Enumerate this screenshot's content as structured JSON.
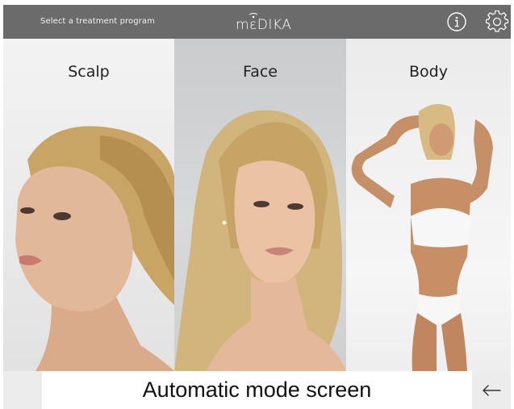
{
  "header": {
    "prompt": "Select a treatment program",
    "logo_text": "mɛDIKA",
    "icons": {
      "info": "info-icon",
      "settings": "gear-icon"
    }
  },
  "panels": [
    {
      "id": "scalp",
      "label": "Scalp"
    },
    {
      "id": "face",
      "label": "Face"
    },
    {
      "id": "body",
      "label": "Body"
    }
  ],
  "footer": {
    "caption": "Automatic mode screen",
    "back_icon": "arrow-left-icon"
  },
  "colors": {
    "header_bg": "#6b6b6b",
    "footer_side_bg": "#ececec",
    "text_dark": "#222222"
  }
}
